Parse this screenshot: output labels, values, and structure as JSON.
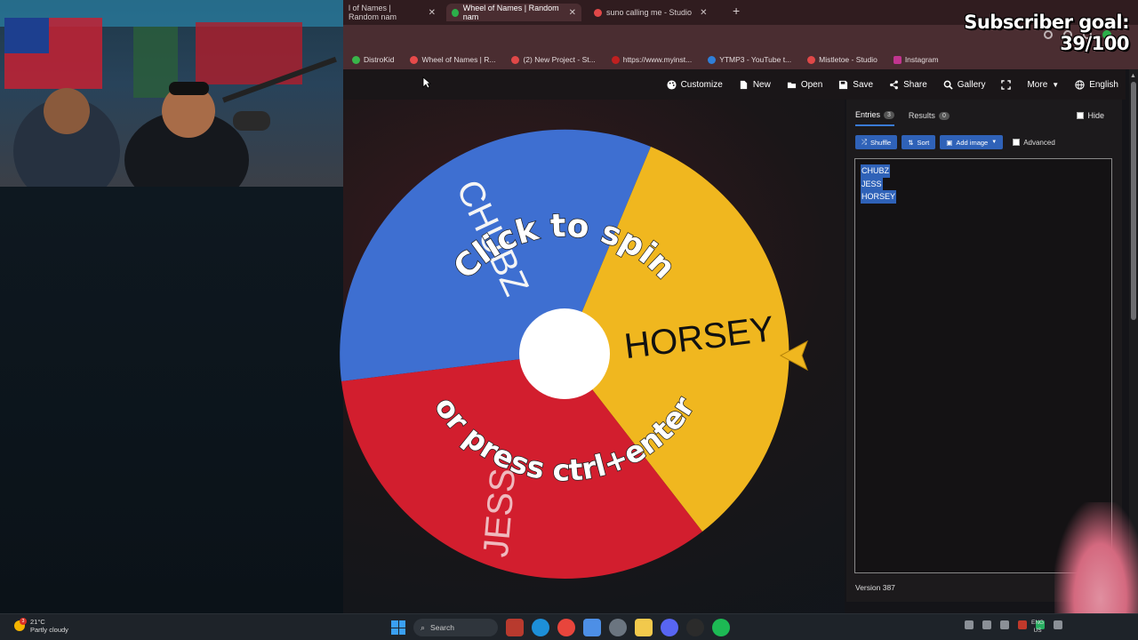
{
  "tabs": [
    {
      "label": "l of Names | Random nam",
      "color": "#c94a4a",
      "active": false
    },
    {
      "label": "Wheel of Names | Random nam",
      "color": "#2bb04a",
      "active": true
    },
    {
      "label": "suno calling me - Studio",
      "color": "#e04848",
      "active": false
    }
  ],
  "bookmarks": [
    {
      "label": "DistroKid",
      "color": "#39b54a"
    },
    {
      "label": "Wheel of Names | R...",
      "color": "#e64a4a"
    },
    {
      "label": "(2) New Project - St...",
      "color": "#e04848"
    },
    {
      "label": "https://www.myinst...",
      "color": "#c02020"
    },
    {
      "label": "YTMP3 - YouTube t...",
      "color": "#2f7fd8"
    },
    {
      "label": "Mistletoe - Studio",
      "color": "#e04848"
    },
    {
      "label": "Instagram",
      "color": "#c1358f"
    }
  ],
  "nav": {
    "customize": "Customize",
    "new": "New",
    "open": "Open",
    "save": "Save",
    "share": "Share",
    "gallery": "Gallery",
    "more": "More",
    "language": "English"
  },
  "wheel": {
    "click_text": "Click to spin",
    "press_text": "or press ctrl+enter",
    "segments": [
      {
        "name": "CHUBZ",
        "color": "#3e6fd1"
      },
      {
        "name": "HORSEY",
        "color": "#f0b71f"
      },
      {
        "name": "JESS",
        "color": "#d21e2e"
      }
    ]
  },
  "panel": {
    "entries_tab": "Entries",
    "entries_count": "3",
    "results_tab": "Results",
    "results_count": "0",
    "hide_label": "Hide",
    "shuffle_label": "Shuffle",
    "sort_label": "Sort",
    "add_image_label": "Add image",
    "advanced_label": "Advanced",
    "entries": [
      "CHUBZ",
      "JESS",
      "HORSEY"
    ],
    "version": "Version 387"
  },
  "overlay": {
    "subscriber_goal": "Subscriber goal: 39/100"
  },
  "taskbar": {
    "temperature": "21°C",
    "weather": "Partly cloudy",
    "weather_badge": "3",
    "search_label": "Search",
    "lang_top": "ENG",
    "lang_bottom": "US"
  }
}
